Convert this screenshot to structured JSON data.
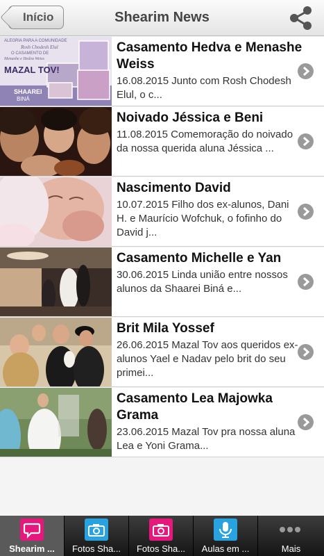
{
  "header": {
    "back_label": "Início",
    "title": "Shearim News"
  },
  "news": [
    {
      "title": "Casamento Hedva e Menashe Weiss",
      "description": "16.08.2015 Junto com Rosh Chodesh Elul, o c...",
      "thumb_text": [
        "ALEGRIA PARA A COMUNIDADE",
        "Rosh Chodesh Elul",
        "O CASAMENTO DE",
        "Menashe e Hedva Weiss",
        "MAZAL TOV!",
        "SHAAREI",
        "BINÁ"
      ]
    },
    {
      "title": "Noivado Jéssica e Beni",
      "description": "11.08.2015 Comemoração do noivado da nossa querida aluna Jéssica ..."
    },
    {
      "title": "Nascimento David",
      "description": "10.07.2015 Filho dos ex-alunos, Dani H. e Maurício Wofchuk, o fofinho do David j..."
    },
    {
      "title": "Casamento Michelle e Yan",
      "description": "30.06.2015 Linda união entre nossos alunos da Shaarei Biná e..."
    },
    {
      "title": "Brit Mila Yossef",
      "description": "26.06.2015 Mazal Tov aos queridos ex-alunos Yael e Nadav pelo brit do seu primei..."
    },
    {
      "title": "Casamento Lea Majowka Grama",
      "description": "23.06.2015 Mazal Tov pra nossa aluna Lea e Yoni Grama..."
    }
  ],
  "tabs": [
    {
      "label": "Shearim ...",
      "icon": "chat-icon",
      "color": "#e6177d"
    },
    {
      "label": "Fotos Sha...",
      "icon": "camera-icon",
      "color": "#29a3e0"
    },
    {
      "label": "Fotos Sha...",
      "icon": "camera-icon",
      "color": "#e6177d"
    },
    {
      "label": "Aulas em ...",
      "icon": "microphone-icon",
      "color": "#29a3e0"
    },
    {
      "label": "Mais",
      "icon": "more-icon",
      "color": "#8a8a8a"
    }
  ]
}
